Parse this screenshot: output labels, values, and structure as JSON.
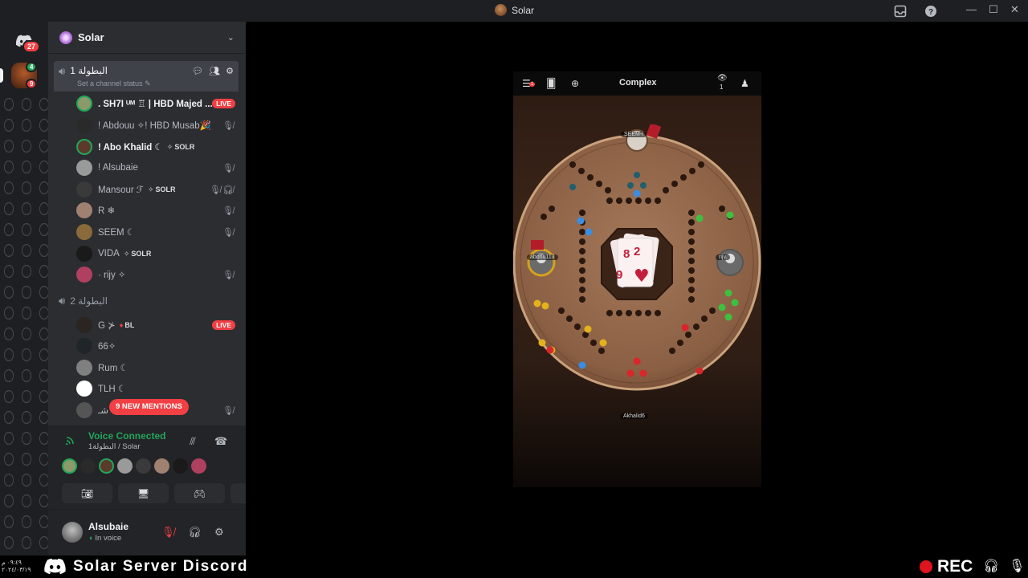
{
  "window": {
    "title": "Solar"
  },
  "rail": {
    "dm_badge": "27",
    "server_badge_top": "4",
    "server_badge_bottom": "9"
  },
  "server": {
    "name": "Solar"
  },
  "channels": [
    {
      "name": "البطولة 1",
      "status_placeholder": "Set a channel status",
      "members": [
        {
          "name": ". SH7I ᵁᴹ ♖ | HBD Majed ...",
          "bright": true,
          "live": "LIVE",
          "avatar": "#8a9a6b"
        },
        {
          "name": "! Abdouu ✧! HBD Musab🎉",
          "muted": true,
          "avatar": "#2a2a2a"
        },
        {
          "name": "! Abo Khalid ☾",
          "bright": true,
          "tag": "SOLR",
          "avatar": "#5a3a2a"
        },
        {
          "name": "! Alsubaie",
          "muted": true,
          "avatar": "#9a9a9a"
        },
        {
          "name": "Mansour ℱ",
          "tag": "SOLR",
          "muted": true,
          "deaf": true,
          "avatar": "#3a3a3a"
        },
        {
          "name": "R ❄",
          "muted": true,
          "avatar": "#a08070"
        },
        {
          "name": "SEEM ☾",
          "muted": true,
          "avatar": "#8a6a3a"
        },
        {
          "name": "VIDA",
          "tag": "SOLR",
          "avatar": "#1a1a1a"
        },
        {
          "name": "· rijy ✧",
          "muted": true,
          "avatar": "#b04060"
        }
      ]
    },
    {
      "name": "البطولة 2",
      "members": [
        {
          "name": "G ⊁",
          "tag": "BL",
          "live": "LIVE",
          "avatar": "#2a2520"
        },
        {
          "name": "66✧",
          "avatar": "#20252a"
        },
        {
          "name": "Rum ☾",
          "avatar": "#808080"
        },
        {
          "name": "TLH ☾",
          "avatar": "#ffffff"
        },
        {
          "name": "ﺷـ",
          "muted": true,
          "avatar": "#555555"
        }
      ]
    }
  ],
  "mentions": "9 NEW MENTIONS",
  "voice": {
    "status": "Voice Connected",
    "location": "البطولة1 / Solar"
  },
  "user": {
    "name": "Alsubaie",
    "status": "In voice"
  },
  "game": {
    "mode": "Complex",
    "menu_badge": "1",
    "viewers": "1",
    "players": {
      "top": "SEEM-I",
      "left": "abdou113",
      "right": "rijy.",
      "bottom": "Akhalid6"
    },
    "cards": [
      "8",
      "2",
      "9"
    ]
  },
  "bottom": {
    "date_line1": "٠٩:٤٩ م",
    "date_line2": "٢٠٢٤/٠٣/١٩",
    "brand": "Solar Server Discord",
    "rec": "REC"
  },
  "colors": {
    "accent_green": "#23a55a",
    "live_red": "#f23f43",
    "sidebar_bg": "#2b2d31",
    "rail_bg": "#1e1f22"
  }
}
